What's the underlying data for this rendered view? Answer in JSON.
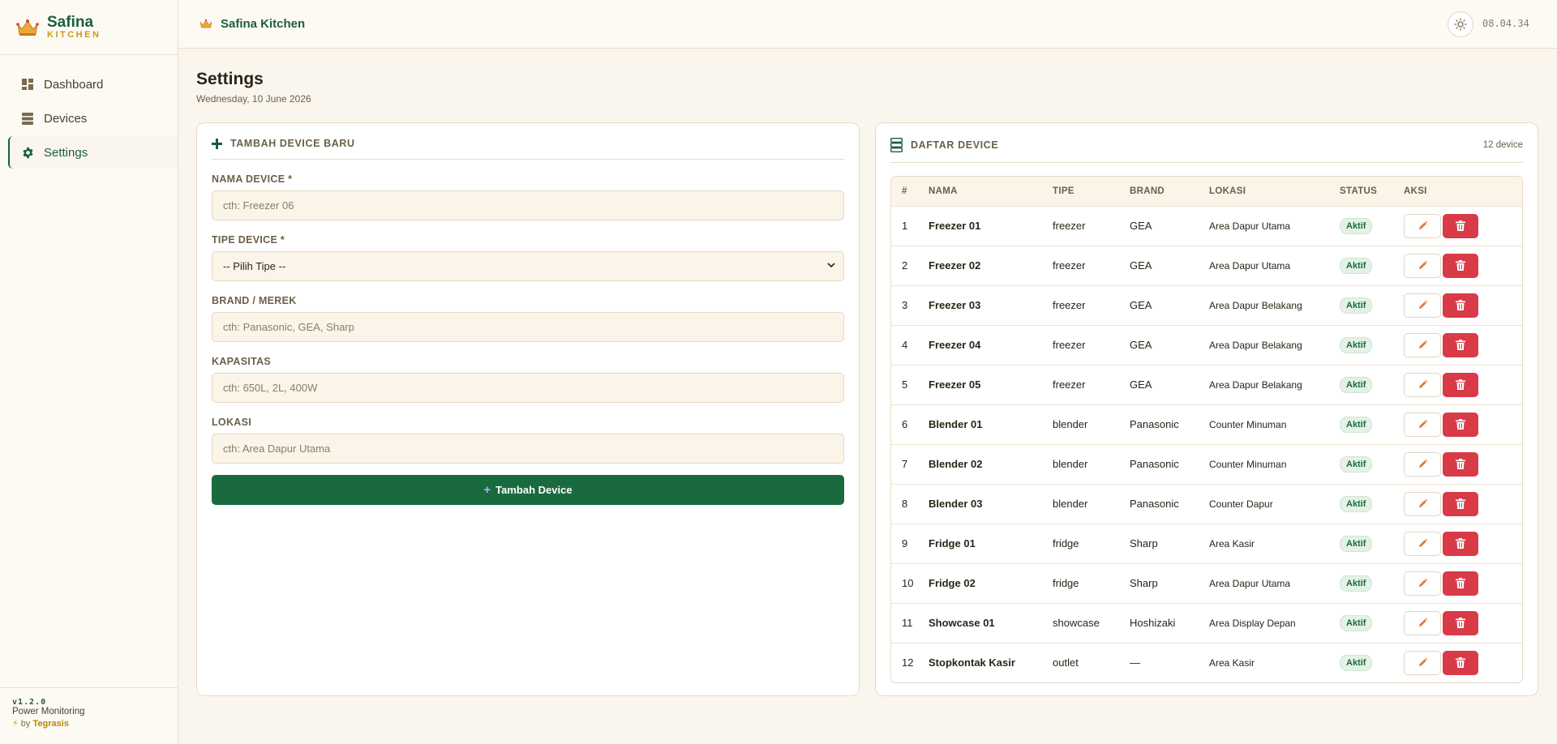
{
  "brand": {
    "name": "Safina",
    "sub": "KITCHEN"
  },
  "sidebar": {
    "items": [
      {
        "label": "Dashboard",
        "icon": "dashboard-icon"
      },
      {
        "label": "Devices",
        "icon": "list-icon"
      },
      {
        "label": "Settings",
        "icon": "gear-icon"
      }
    ],
    "footer": {
      "version": "v1.2.0",
      "app": "Power Monitoring",
      "by_prefix": "by",
      "by_name": "Tegrasis"
    }
  },
  "topbar": {
    "title": "Safina Kitchen",
    "clock": "08.04.34",
    "theme_icon": "sun-icon"
  },
  "page": {
    "title": "Settings",
    "date": "Wednesday, 10 June 2026"
  },
  "form": {
    "heading": "TAMBAH DEVICE BARU",
    "fields": {
      "name": {
        "label": "NAMA DEVICE *",
        "placeholder": "cth: Freezer 06"
      },
      "type": {
        "label": "TIPE DEVICE *",
        "selected": "-- Pilih Tipe --"
      },
      "brand": {
        "label": "BRAND / MEREK",
        "placeholder": "cth: Panasonic, GEA, Sharp"
      },
      "capacity": {
        "label": "KAPASITAS",
        "placeholder": "cth: 650L, 2L, 400W"
      },
      "location": {
        "label": "LOKASI",
        "placeholder": "cth: Area Dapur Utama"
      }
    },
    "submit_label": "Tambah Device"
  },
  "device_list": {
    "heading": "DAFTAR DEVICE",
    "count": "12 device",
    "columns": [
      "#",
      "NAMA",
      "TIPE",
      "BRAND",
      "LOKASI",
      "STATUS",
      "AKSI"
    ],
    "rows": [
      {
        "no": "1",
        "name": "Freezer 01",
        "type": "freezer",
        "brand": "GEA",
        "location": "Area Dapur Utama",
        "status": "Aktif"
      },
      {
        "no": "2",
        "name": "Freezer 02",
        "type": "freezer",
        "brand": "GEA",
        "location": "Area Dapur Utama",
        "status": "Aktif"
      },
      {
        "no": "3",
        "name": "Freezer 03",
        "type": "freezer",
        "brand": "GEA",
        "location": "Area Dapur Belakang",
        "status": "Aktif"
      },
      {
        "no": "4",
        "name": "Freezer 04",
        "type": "freezer",
        "brand": "GEA",
        "location": "Area Dapur Belakang",
        "status": "Aktif"
      },
      {
        "no": "5",
        "name": "Freezer 05",
        "type": "freezer",
        "brand": "GEA",
        "location": "Area Dapur Belakang",
        "status": "Aktif"
      },
      {
        "no": "6",
        "name": "Blender 01",
        "type": "blender",
        "brand": "Panasonic",
        "location": "Counter Minuman",
        "status": "Aktif"
      },
      {
        "no": "7",
        "name": "Blender 02",
        "type": "blender",
        "brand": "Panasonic",
        "location": "Counter Minuman",
        "status": "Aktif"
      },
      {
        "no": "8",
        "name": "Blender 03",
        "type": "blender",
        "brand": "Panasonic",
        "location": "Counter Dapur",
        "status": "Aktif"
      },
      {
        "no": "9",
        "name": "Fridge 01",
        "type": "fridge",
        "brand": "Sharp",
        "location": "Area Kasir",
        "status": "Aktif"
      },
      {
        "no": "10",
        "name": "Fridge 02",
        "type": "fridge",
        "brand": "Sharp",
        "location": "Area Dapur Utama",
        "status": "Aktif"
      },
      {
        "no": "11",
        "name": "Showcase 01",
        "type": "showcase",
        "brand": "Hoshizaki",
        "location": "Area Display Depan",
        "status": "Aktif"
      },
      {
        "no": "12",
        "name": "Stopkontak Kasir",
        "type": "outlet",
        "brand": "—",
        "location": "Area Kasir",
        "status": "Aktif"
      }
    ]
  },
  "colors": {
    "primary": "#1a6a40",
    "accent": "#c79a1c",
    "danger": "#d93a48",
    "background": "#faf6ee"
  }
}
